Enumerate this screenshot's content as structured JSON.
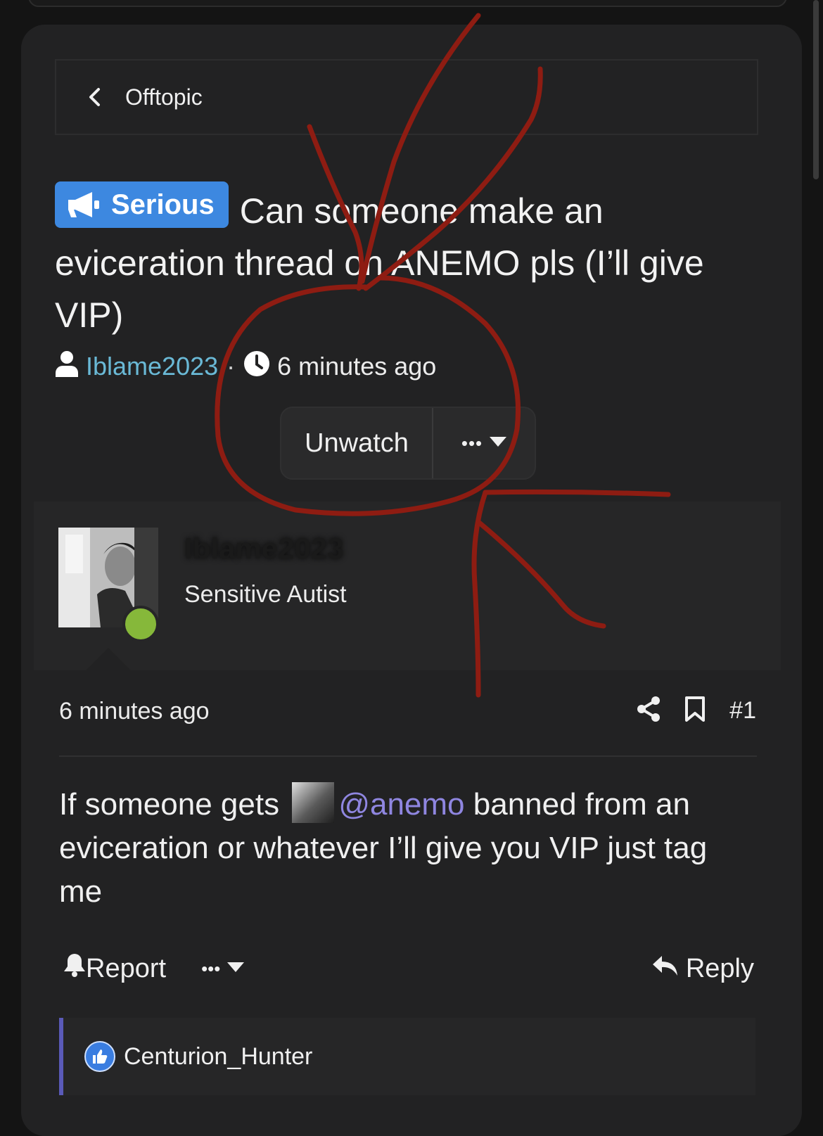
{
  "breadcrumb": {
    "label": "Offtopic"
  },
  "thread": {
    "prefix": "Serious",
    "title": "Can someone make an eviceration thread on ANEMO pls (I’ll give VIP)",
    "author": "Iblame2023",
    "meta_separator": "·",
    "age": "6 minutes ago"
  },
  "watch": {
    "unwatch_label": "Unwatch",
    "more_label": "•••"
  },
  "post": {
    "username": "Iblame2023",
    "user_title": "Sensitive Autist",
    "time": "6 minutes ago",
    "number": "#1",
    "body_before": "If someone gets",
    "mention": "@anemo",
    "body_after": "banned from an eviceration or whatever I’ll give you VIP just tag me",
    "report_label": "Report",
    "more_label": "•••",
    "reply_label": "Reply"
  },
  "reactions": {
    "user": "Centurion_Hunter"
  },
  "colors": {
    "accent_blue": "#3d88e0",
    "author_link": "#6ab9d6",
    "mention": "#8f86e0",
    "online": "#86b83a",
    "scribble_red": "#8e1c12"
  },
  "icons": [
    "chevron-left-icon",
    "megaphone-icon",
    "user-icon",
    "clock-icon",
    "caret-down-icon",
    "share-icon",
    "bookmark-icon",
    "bell-icon",
    "reply-icon",
    "thumbs-up-icon"
  ]
}
